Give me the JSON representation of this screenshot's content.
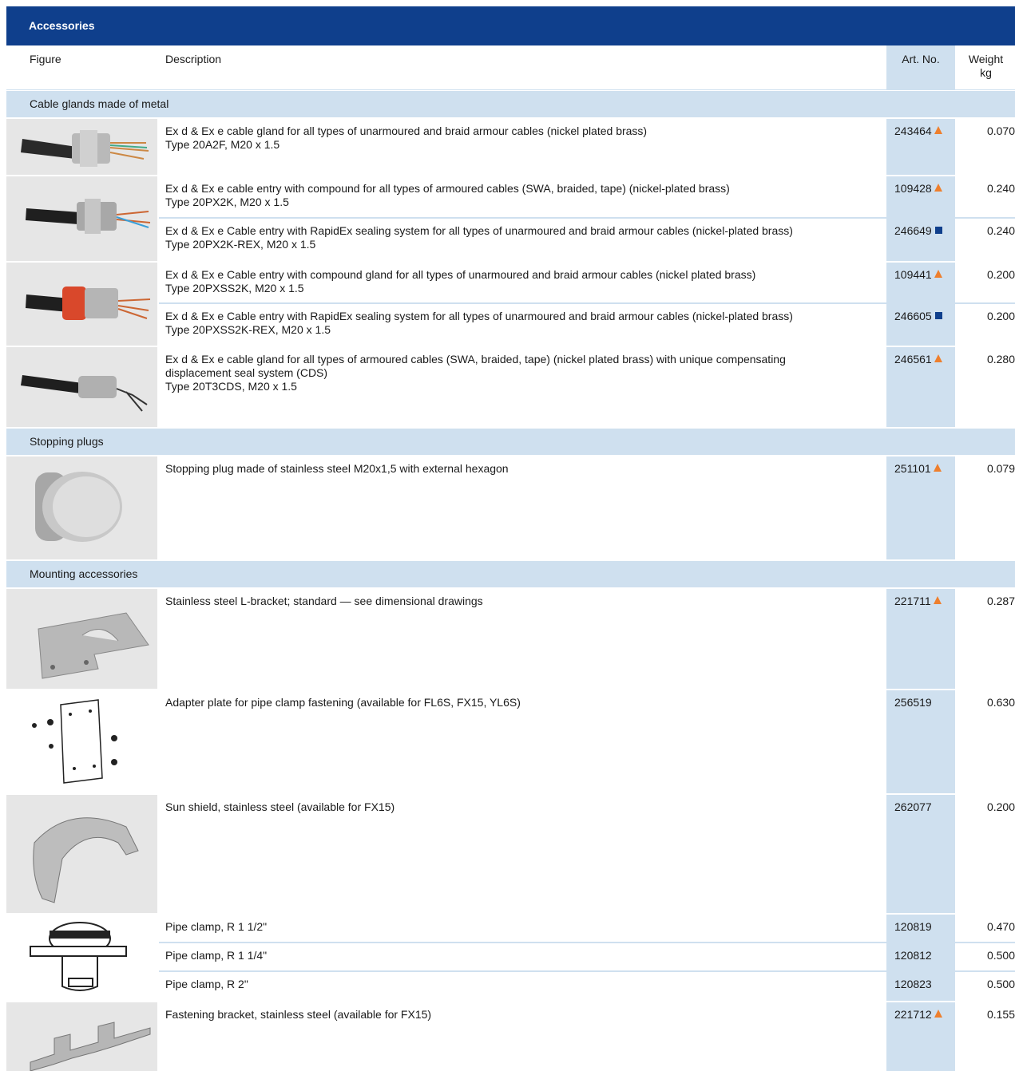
{
  "title": "Accessories",
  "header": {
    "figure": "Figure",
    "description": "Description",
    "art_no": "Art. No.",
    "weight": "Weight",
    "weight_unit": "kg"
  },
  "sections": {
    "glands": "Cable glands made of metal",
    "plugs": "Stopping plugs",
    "mounting": "Mounting accessories"
  },
  "rows": {
    "r1": {
      "desc1": "Ex d & Ex e cable gland for all types of unarmoured and braid armour cables (nickel plated brass)",
      "desc2": "Type 20A2F, M20 x 1.5",
      "art": "243464",
      "weight": "0.070"
    },
    "r2": {
      "desc1": "Ex d & Ex e cable entry with compound for all types of armoured cables (SWA, braided, tape) (nickel-plated brass)",
      "desc2": "Type 20PX2K, M20 x 1.5",
      "art": "109428",
      "weight": "0.240"
    },
    "r3": {
      "desc1": "Ex d & Ex e Cable entry with RapidEx sealing system for all types of unarmoured and braid armour cables (nickel-plated brass)",
      "desc2": "Type 20PX2K-REX, M20 x 1.5",
      "art": "246649",
      "weight": "0.240"
    },
    "r4": {
      "desc1": "Ex d & Ex e Cable entry with compound gland for all types of unarmoured and braid armour cables (nickel plated brass)",
      "desc2": "Type 20PXSS2K, M20 x 1.5",
      "art": "109441",
      "weight": "0.200"
    },
    "r5": {
      "desc1": "Ex d & Ex e Cable entry with RapidEx sealing system for all types of unarmoured and braid armour cables (nickel-plated brass)",
      "desc2": "Type 20PXSS2K-REX, M20 x 1.5",
      "art": "246605",
      "weight": "0.200"
    },
    "r6": {
      "desc1": "Ex d & Ex e cable gland for all types of armoured cables (SWA, braided, tape) (nickel plated brass) with unique compensating",
      "desc1b": "displacement seal system (CDS)",
      "desc2": "Type 20T3CDS, M20 x 1.5",
      "art": "246561",
      "weight": "0.280"
    },
    "r7": {
      "desc1": "Stopping plug made of stainless steel M20x1,5 with external hexagon",
      "art": "251101",
      "weight": "0.079"
    },
    "r8": {
      "desc1": "Stainless steel L-bracket; standard — see dimensional drawings",
      "art": "221711",
      "weight": "0.287"
    },
    "r9": {
      "desc1": "Adapter plate for pipe clamp fastening (available for FL6S, FX15, YL6S)",
      "art": "256519",
      "weight": "0.630"
    },
    "r10": {
      "desc1": "Sun shield, stainless steel (available for FX15)",
      "art": "262077",
      "weight": "0.200"
    },
    "r11": {
      "desc1": "Pipe clamp, R 1 1/2\"",
      "art": "120819",
      "weight": "0.470"
    },
    "r12": {
      "desc1": "Pipe clamp, R 1 1/4\"",
      "art": "120812",
      "weight": "0.500"
    },
    "r13": {
      "desc1": "Pipe clamp, R 2\"",
      "art": "120823",
      "weight": "0.500"
    },
    "r14": {
      "desc1": "Fastening bracket, stainless steel (available for FX15)",
      "art": "221712",
      "weight": "0.155"
    }
  },
  "markers": {
    "triangle_color": "#ee7f2d",
    "square_color": "#0f3f8c"
  },
  "colors": {
    "title_bg": "#0f3f8c",
    "accent_light": "#cfe0ef",
    "figure_bg": "#e6e6e6"
  }
}
